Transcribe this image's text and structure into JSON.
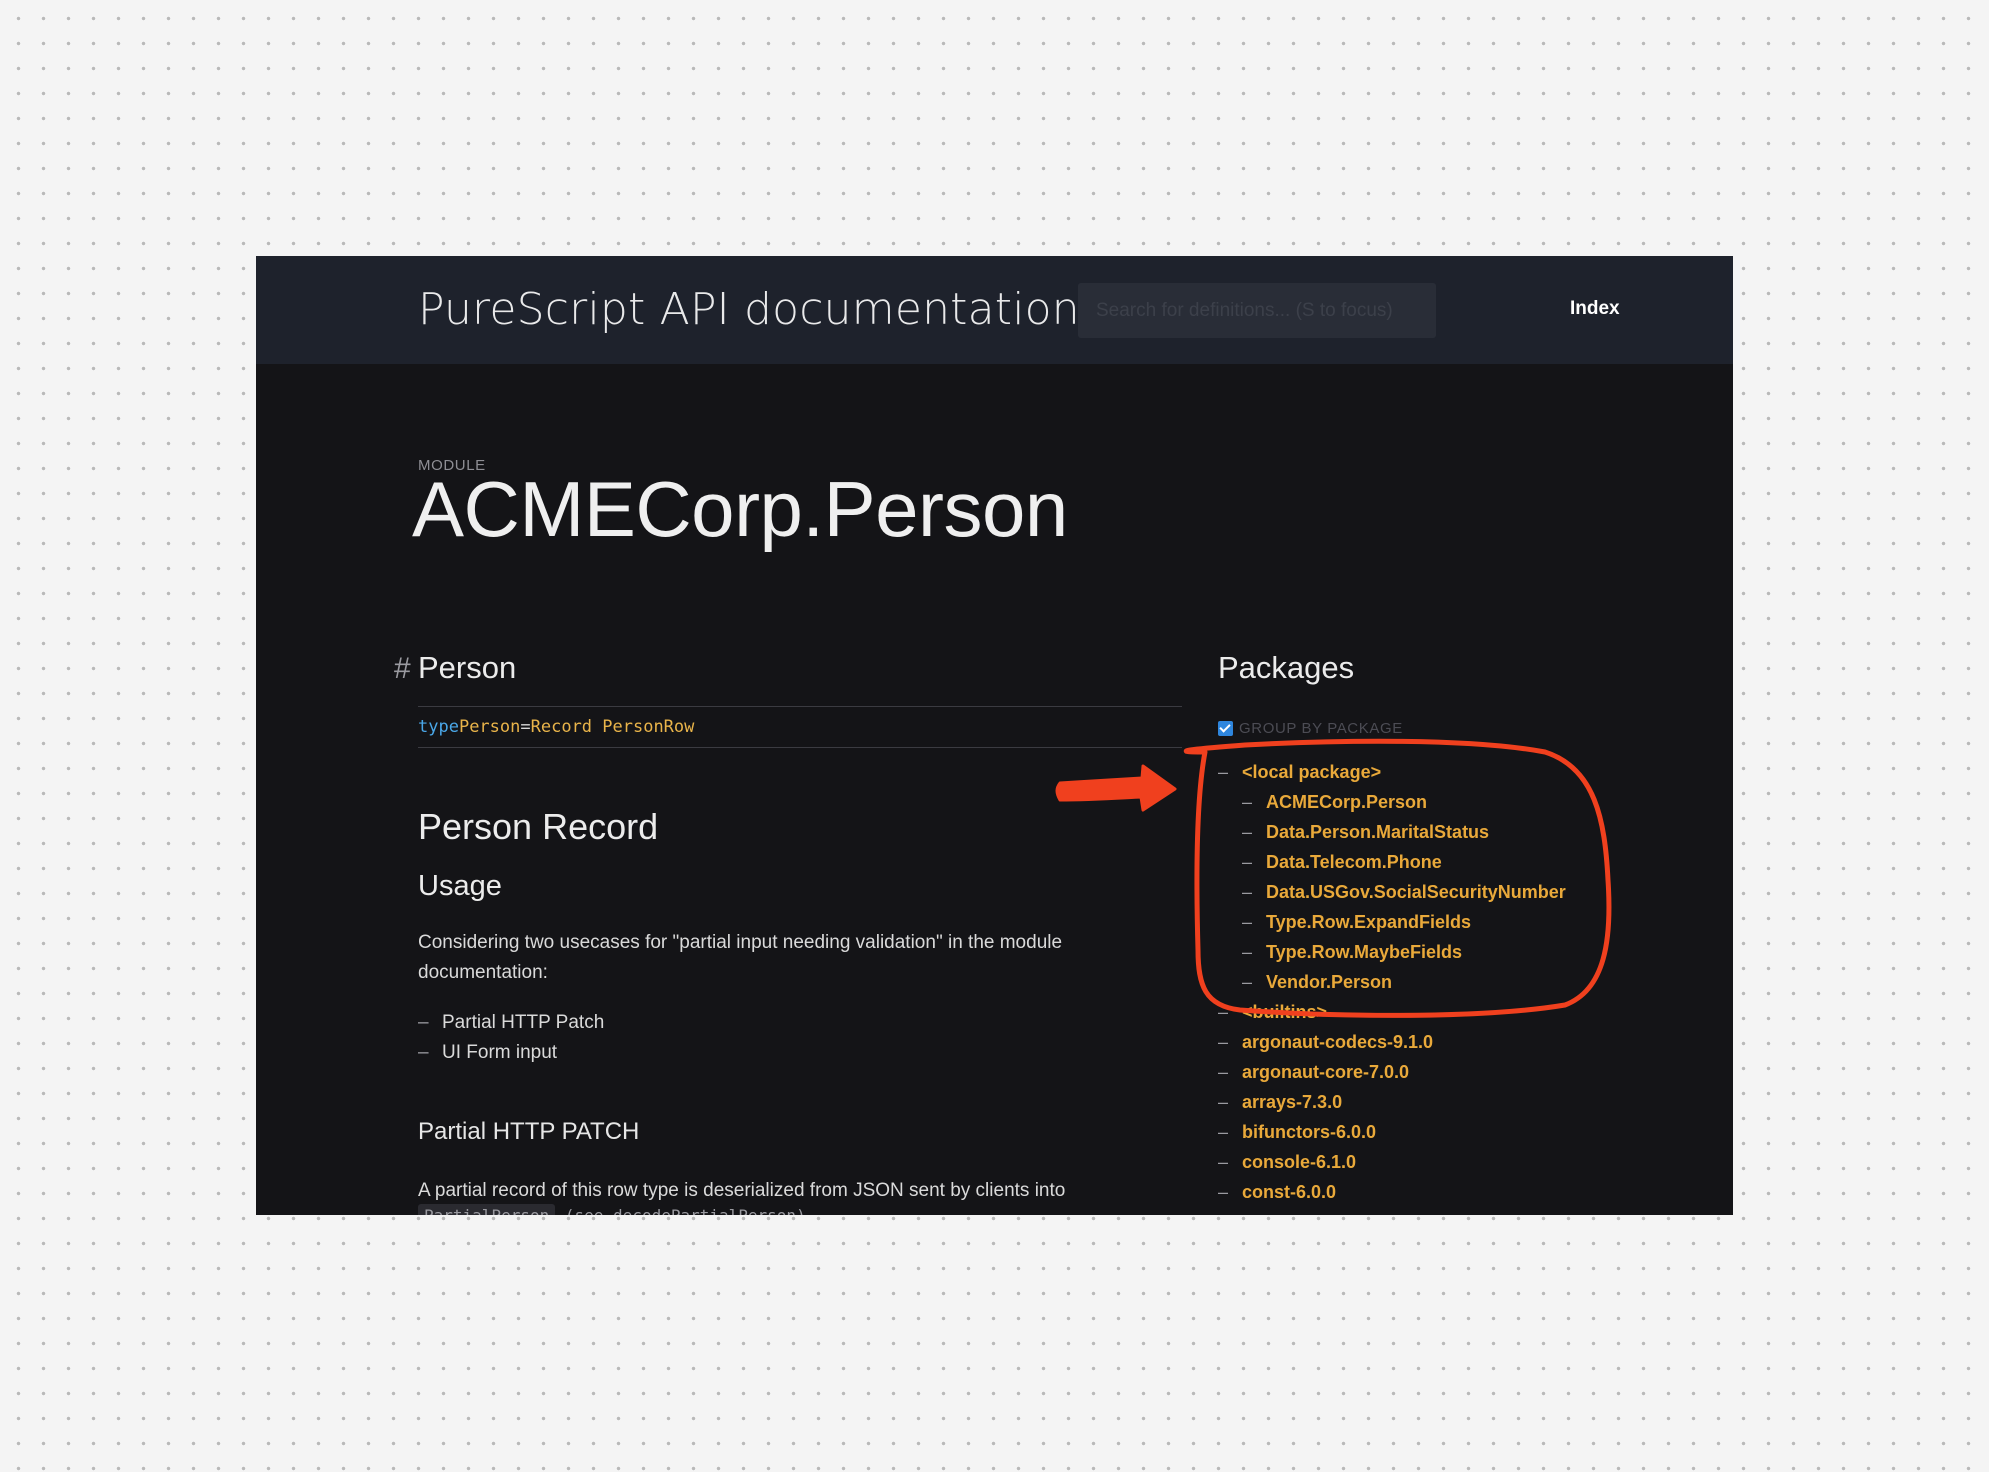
{
  "header": {
    "site_title": "PureScript API documentation",
    "search_placeholder": "Search for definitions... (S to focus)",
    "index_label": "Index"
  },
  "module": {
    "label": "MODULE",
    "title": "ACMECorp.Person"
  },
  "declaration": {
    "hash": "#",
    "name": "Person",
    "signature": {
      "keyword": "type",
      "name": "Person",
      "equals": "=",
      "rhs": "Record PersonRow"
    }
  },
  "doc": {
    "section_title": "Person Record",
    "usage_title": "Usage",
    "usage_text": "Considering two usecases for \"partial input needing validation\" in the module documentation:",
    "usecases": [
      "Partial HTTP Patch",
      "UI Form input"
    ],
    "patch_title": "Partial HTTP PATCH",
    "patch_text": "A partial record of this row type is deserialized from JSON sent by clients into",
    "patch_code": "PartialPerson",
    "patch_code_note": "(see decodePartialPerson)"
  },
  "sidebar": {
    "title": "Packages",
    "group_label": "GROUP BY PACKAGE",
    "group_checked": true,
    "local_package": "<local package>",
    "local_modules": [
      "ACMECorp.Person",
      "Data.Person.MaritalStatus",
      "Data.Telecom.Phone",
      "Data.USGov.SocialSecurityNumber",
      "Type.Row.ExpandFields",
      "Type.Row.MaybeFields",
      "Vendor.Person"
    ],
    "builtins": "<builtins>",
    "packages": [
      "argonaut-codecs-9.1.0",
      "argonaut-core-7.0.0",
      "arrays-7.3.0",
      "bifunctors-6.0.0",
      "console-6.1.0",
      "const-6.0.0"
    ]
  },
  "annotation": {
    "color": "#f0401e",
    "arrow_icon": "arrow-right-icon",
    "highlight": "circled local package list"
  }
}
